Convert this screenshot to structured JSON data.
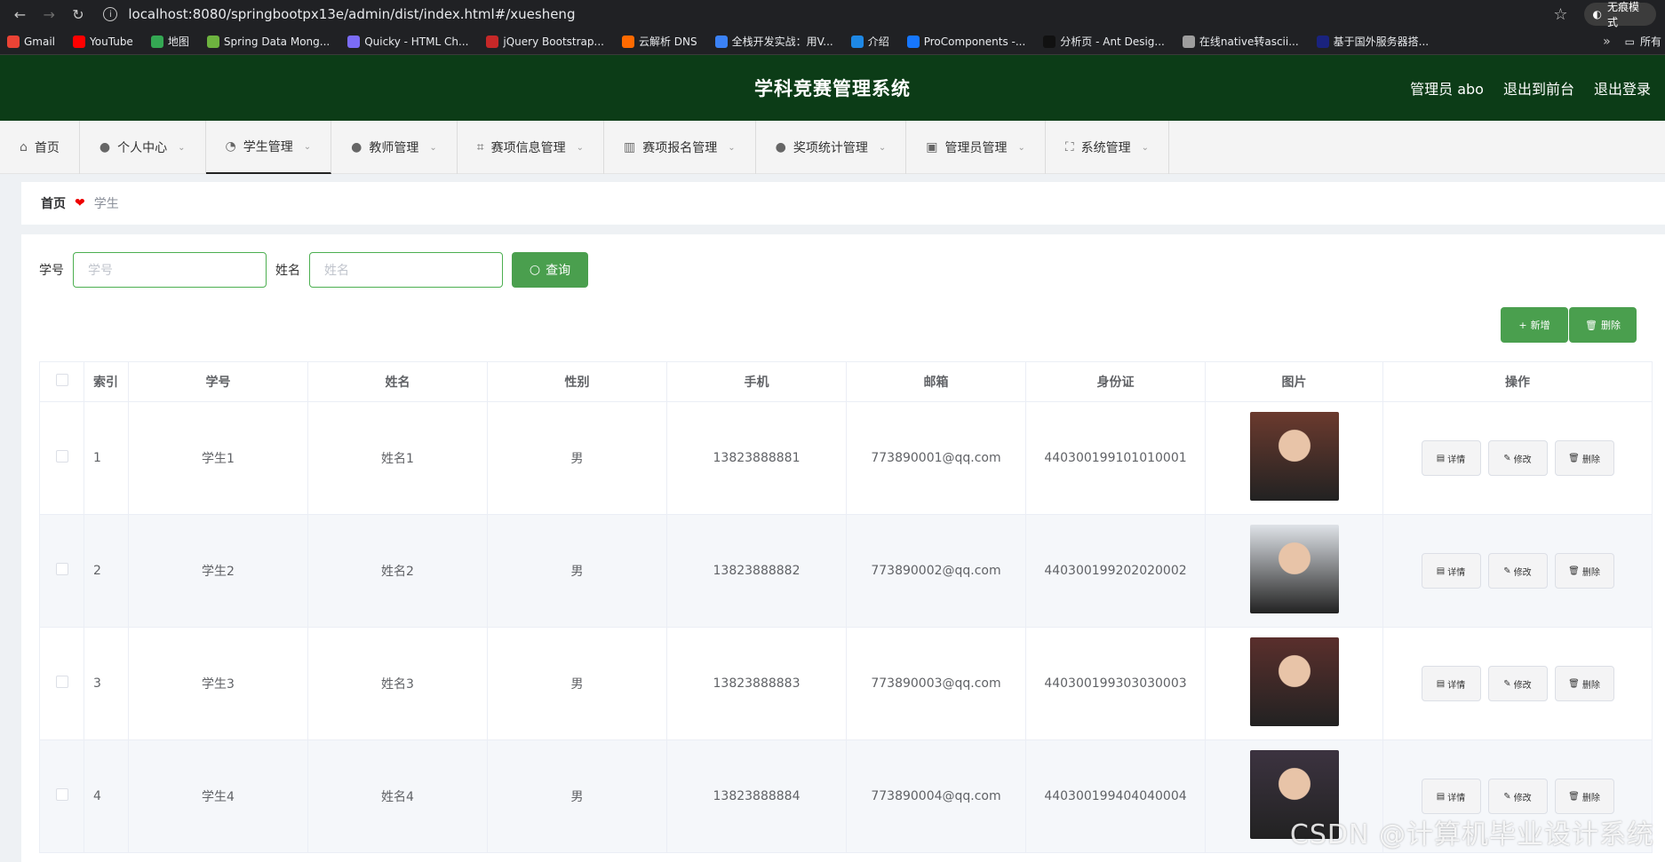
{
  "browser": {
    "url": "localhost:8080/springbootpx13e/admin/dist/index.html#/xuesheng",
    "incognito_label": "无痕模式",
    "bookmarks": [
      {
        "label": "Gmail",
        "color": "#ea4335"
      },
      {
        "label": "YouTube",
        "color": "#ff0000"
      },
      {
        "label": "地图",
        "color": "#34a853"
      },
      {
        "label": "Spring Data Mong...",
        "color": "#6db33f"
      },
      {
        "label": "Quicky - HTML Ch...",
        "color": "#7b6cf6"
      },
      {
        "label": "jQuery Bootstrap...",
        "color": "#c62828"
      },
      {
        "label": "云解析 DNS",
        "color": "#ff6a00"
      },
      {
        "label": "全栈开发实战：用V...",
        "color": "#3b82f6"
      },
      {
        "label": "介绍",
        "color": "#1e88e5"
      },
      {
        "label": "ProComponents -...",
        "color": "#1677ff"
      },
      {
        "label": "分析页 - Ant Desig...",
        "color": "#111111"
      },
      {
        "label": "在线native转ascii...",
        "color": "#9e9e9e"
      },
      {
        "label": "基于国外服务器搭...",
        "color": "#1a237e"
      }
    ],
    "bookmarks_more": "»",
    "all_bookmarks": "所有"
  },
  "header": {
    "title": "学科竞赛管理系统",
    "admin": "管理员 abo",
    "back_front": "退出到前台",
    "logout": "退出登录"
  },
  "menu": [
    {
      "label": "首页",
      "icon": "home-icon",
      "glyph": "⌂",
      "caret": false
    },
    {
      "label": "个人中心",
      "icon": "user-icon",
      "glyph": "●",
      "caret": true
    },
    {
      "label": "学生管理",
      "icon": "gauge-icon",
      "glyph": "◔",
      "caret": true
    },
    {
      "label": "教师管理",
      "icon": "user-icon",
      "glyph": "●",
      "caret": true
    },
    {
      "label": "赛项信息管理",
      "icon": "crop-icon",
      "glyph": "⌗",
      "caret": true
    },
    {
      "label": "赛项报名管理",
      "icon": "bar-chart-icon",
      "glyph": "▥",
      "caret": true
    },
    {
      "label": "奖项统计管理",
      "icon": "bulb-icon",
      "glyph": "●",
      "caret": true
    },
    {
      "label": "管理员管理",
      "icon": "clipboard-icon",
      "glyph": "▣",
      "caret": true
    },
    {
      "label": "系统管理",
      "icon": "fullscreen-icon",
      "glyph": "⛶",
      "caret": true
    }
  ],
  "breadcrumb": {
    "home": "首页",
    "current": "学生"
  },
  "search": {
    "id_label": "学号",
    "id_placeholder": "学号",
    "name_label": "姓名",
    "name_placeholder": "姓名",
    "query_label": "查询"
  },
  "actions": {
    "add_label": "新增",
    "delete_label": "删除"
  },
  "table": {
    "columns": [
      "索引",
      "学号",
      "姓名",
      "性别",
      "手机",
      "邮箱",
      "身份证",
      "图片",
      "操作"
    ],
    "row_actions": {
      "detail": "详情",
      "edit": "修改",
      "delete": "删除"
    },
    "rows": [
      {
        "index": "1",
        "student_id": "学生1",
        "name": "姓名1",
        "gender": "男",
        "phone": "13823888881",
        "email": "773890001@qq.com",
        "id_card": "440300199101010001",
        "photo_color": "#6b3a2e"
      },
      {
        "index": "2",
        "student_id": "学生2",
        "name": "姓名2",
        "gender": "男",
        "phone": "13823888882",
        "email": "773890002@qq.com",
        "id_card": "440300199202020002",
        "photo_color": "#dfe3e8"
      },
      {
        "index": "3",
        "student_id": "学生3",
        "name": "姓名3",
        "gender": "男",
        "phone": "13823888883",
        "email": "773890003@qq.com",
        "id_card": "440300199303030003",
        "photo_color": "#5a2f2c"
      },
      {
        "index": "4",
        "student_id": "学生4",
        "name": "姓名4",
        "gender": "男",
        "phone": "13823888884",
        "email": "773890004@qq.com",
        "id_card": "440300199404040004",
        "photo_color": "#3c3340"
      }
    ]
  },
  "watermark": "CSDN @计算机毕业设计系统"
}
